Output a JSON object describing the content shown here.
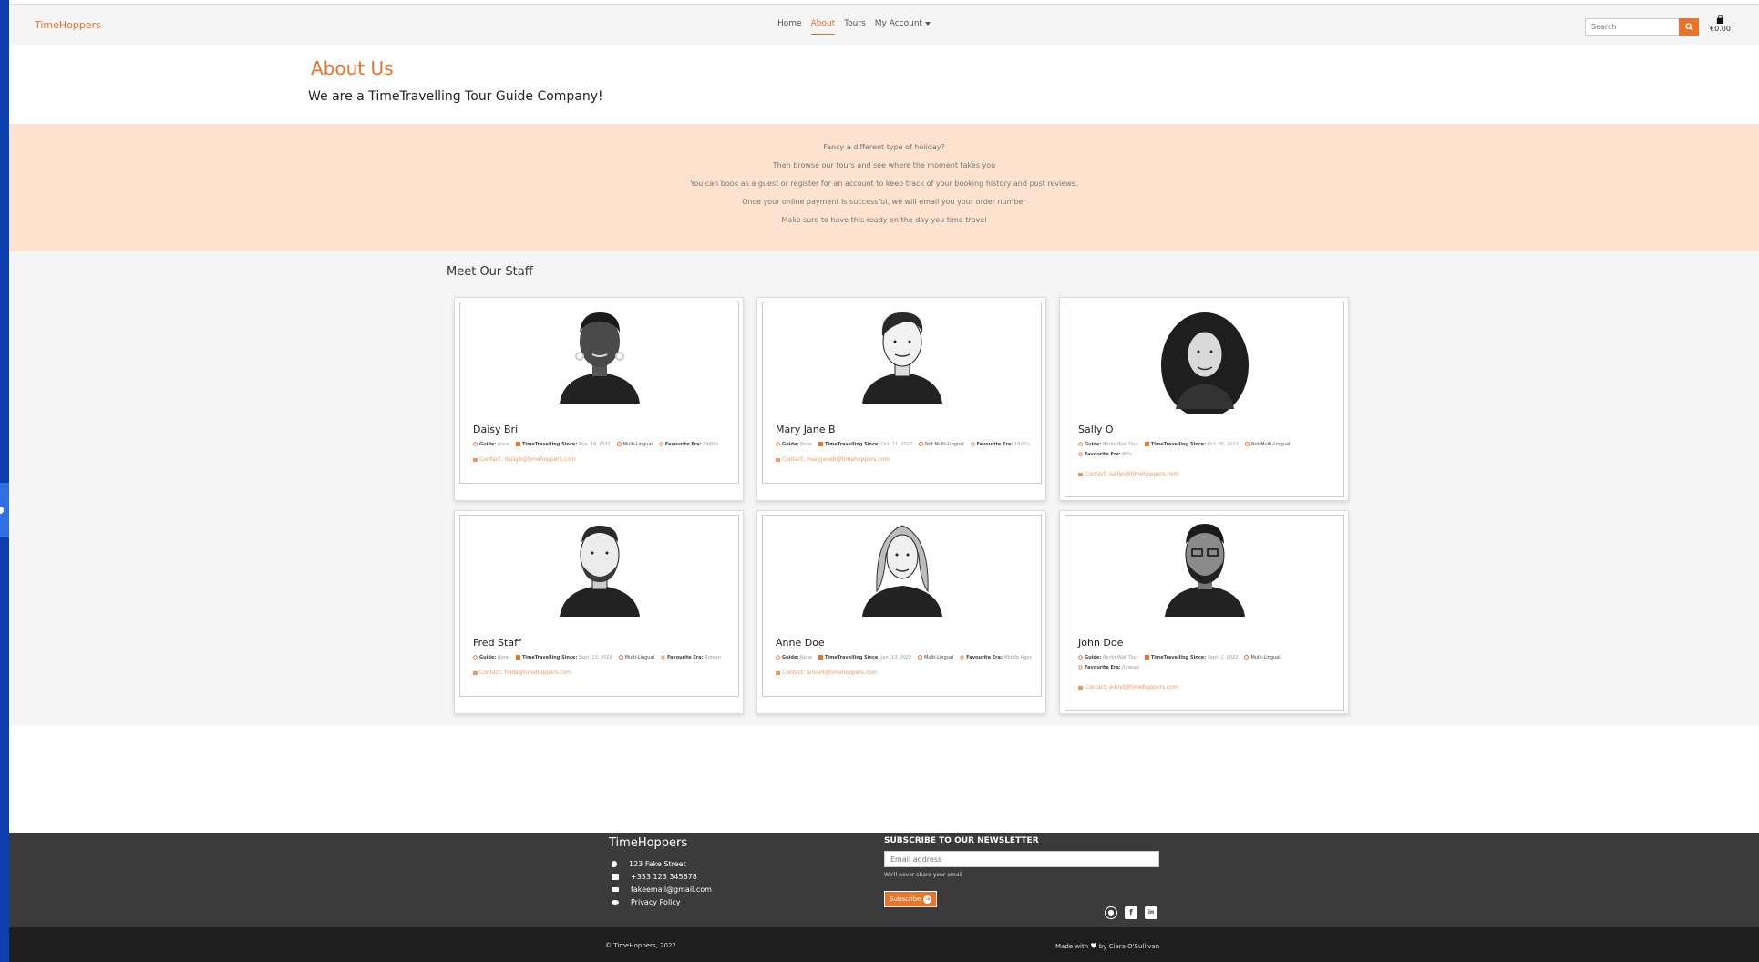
{
  "brand": "TimeHoppers",
  "nav": {
    "links": [
      "Home",
      "About",
      "Tours",
      "My Account"
    ],
    "active": "About"
  },
  "search": {
    "placeholder": "Search"
  },
  "bag": {
    "total": "€0.00"
  },
  "about": {
    "title": "About Us",
    "subtitle": "We are a TimeTravelling Tour Guide Company!"
  },
  "info": {
    "lines": [
      "Fancy a different type of holiday?",
      "Then browse our tours and see where the moment takes you",
      "You can book as a guest or register for an account to keep track of your booking history and post reviews.",
      "Once your online payment is successful, we will email you your order number",
      "Make sure to have this ready on the day you time travel"
    ]
  },
  "staff": {
    "title": "Meet Our Staff",
    "labels": {
      "guide": "Guide:",
      "since": "TimeTravelling Since:",
      "era": "Favourite Era:",
      "contact_prefix": "Contact:"
    },
    "members": [
      {
        "name": "Daisy Bri",
        "guide": "None",
        "since": "Nov. 19, 2021",
        "lingual": "Multi-Lingual",
        "era": "1960's",
        "email": "daisyb@timehoppers.com"
      },
      {
        "name": "Mary Jane B",
        "guide": "None",
        "since": "Oct. 11, 2022",
        "lingual": "Not Multi-Lingual",
        "era": "1920's",
        "email": "maryjaneb@timehoppers.com"
      },
      {
        "name": "Sally O",
        "guide": "Berlin Wall Tour",
        "since": "Oct. 25, 2022",
        "lingual": "Not Multi-Lingual",
        "era": "80's",
        "email": "sallyo@timehoppers.com"
      },
      {
        "name": "Fred Staff",
        "guide": "None",
        "since": "Sept. 13, 2019",
        "lingual": "Multi-Lingual",
        "era": "Roman",
        "email": "freds@timehoppers.com"
      },
      {
        "name": "Anne Doe",
        "guide": "None",
        "since": "Jan. 13, 2022",
        "lingual": "Multi-Lingual",
        "era": "Middle Ages",
        "email": "anned@timehoppers.com"
      },
      {
        "name": "John Doe",
        "guide": "Berlin Wall Tour",
        "since": "Sept. 1, 2022",
        "lingual": "Multi-Lingual",
        "era": "Jurassic",
        "email": "johnd@timehoppers.com"
      }
    ]
  },
  "footer": {
    "brand": "TimeHoppers",
    "address": "123 Fake Street",
    "phone": "+353 123 345678",
    "email": "fakeemail@gmail.com",
    "privacy": "Privacy Policy",
    "newsletter_title": "SUBSCRIBE TO OUR NEWSLETTER",
    "newsletter_placeholder": "Email address",
    "newsletter_note": "We'll never share your email",
    "subscribe_label": "Subscribe",
    "copyright": "© TimeHoppers, 2022",
    "made_prefix": "Made with",
    "made_suffix": "by Ciara O'Sullivan"
  },
  "icons": [
    "search-icon",
    "shopping-bag-icon",
    "caret-down-icon",
    "star-icon",
    "calendar-icon",
    "language-icon",
    "heart-icon",
    "envelope-icon",
    "map-pin-icon",
    "phone-icon",
    "eye-icon",
    "arrow-right-circle-icon",
    "github-icon",
    "facebook-icon",
    "linkedin-icon"
  ],
  "colors": {
    "accent": "#e8742b",
    "info_band": "#fde2d0",
    "staff_bg": "#f5f5f5",
    "footer": "#3b3b3b",
    "bottom_bar": "#1e1e1e"
  }
}
